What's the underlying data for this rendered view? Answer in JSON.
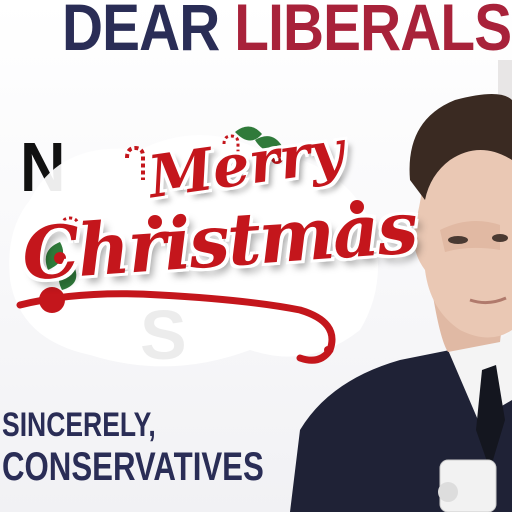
{
  "headline": {
    "word1": "DEAR",
    "word2": "LIBERALS"
  },
  "partial_words": {
    "top": "N",
    "bottom": "S"
  },
  "sign_off": {
    "line1": "SINCERELY,",
    "line2": "CONSERVATIVES"
  },
  "sticker": {
    "line1": "Merry",
    "line2": "Christmas"
  },
  "colors": {
    "navy": "#2a2d56",
    "crimson": "#a8223a",
    "sticker_red": "#c4161c",
    "holly_green": "#2f7a3a"
  }
}
